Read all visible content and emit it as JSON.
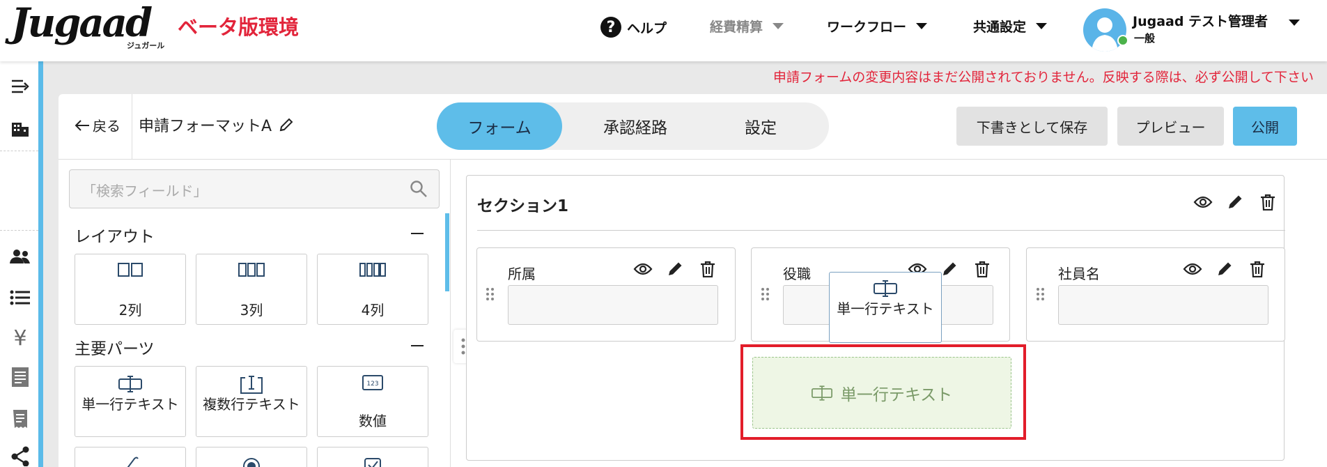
{
  "header": {
    "logo_text": "Jugaad",
    "logo_sub": "ジュガール",
    "env_label": "ベータ版環境",
    "nav": {
      "help": "ヘルプ",
      "expense": "経費精算",
      "workflow": "ワークフロー",
      "common_settings": "共通設定"
    },
    "user": {
      "name": "Jugaad テスト管理者",
      "role": "一般",
      "status_color": "#4bb24a"
    }
  },
  "rail_icons": [
    "collapse-sidebar-icon",
    "building-icon",
    "users-icon",
    "list-icon",
    "yen-icon",
    "document-icon",
    "receipt-icon",
    "share-icon"
  ],
  "warning_text": "申請フォームの変更内容はまだ公開されておりません。反映する際は、必ず公開して下さい",
  "toolbar": {
    "back_label": "戻る",
    "form_name": "申請フォーマットA",
    "tabs": [
      {
        "label": "フォーム",
        "active": true
      },
      {
        "label": "承認経路",
        "active": false
      },
      {
        "label": "設定",
        "active": false
      }
    ],
    "save_draft_label": "下書きとして保存",
    "preview_label": "プレビュー",
    "publish_label": "公開"
  },
  "palette": {
    "search_placeholder": "「検索フィールド」",
    "layout_title": "レイアウト",
    "layout_items": [
      "2列",
      "3列",
      "4列"
    ],
    "parts_title": "主要パーツ",
    "parts_items": [
      "単一行テキスト",
      "複数行テキスト",
      "数値"
    ]
  },
  "canvas": {
    "section_title": "セクション1",
    "fields": [
      "所属",
      "役職",
      "社員名"
    ],
    "dragging_item_label": "単一行テキスト",
    "drop_zone_label": "単一行テキスト"
  },
  "colors": {
    "accent": "#5ebde9",
    "brand_red": "#e2243a",
    "highlight_border": "#e21d2a",
    "drop_zone_bg": "#eef6e5"
  }
}
